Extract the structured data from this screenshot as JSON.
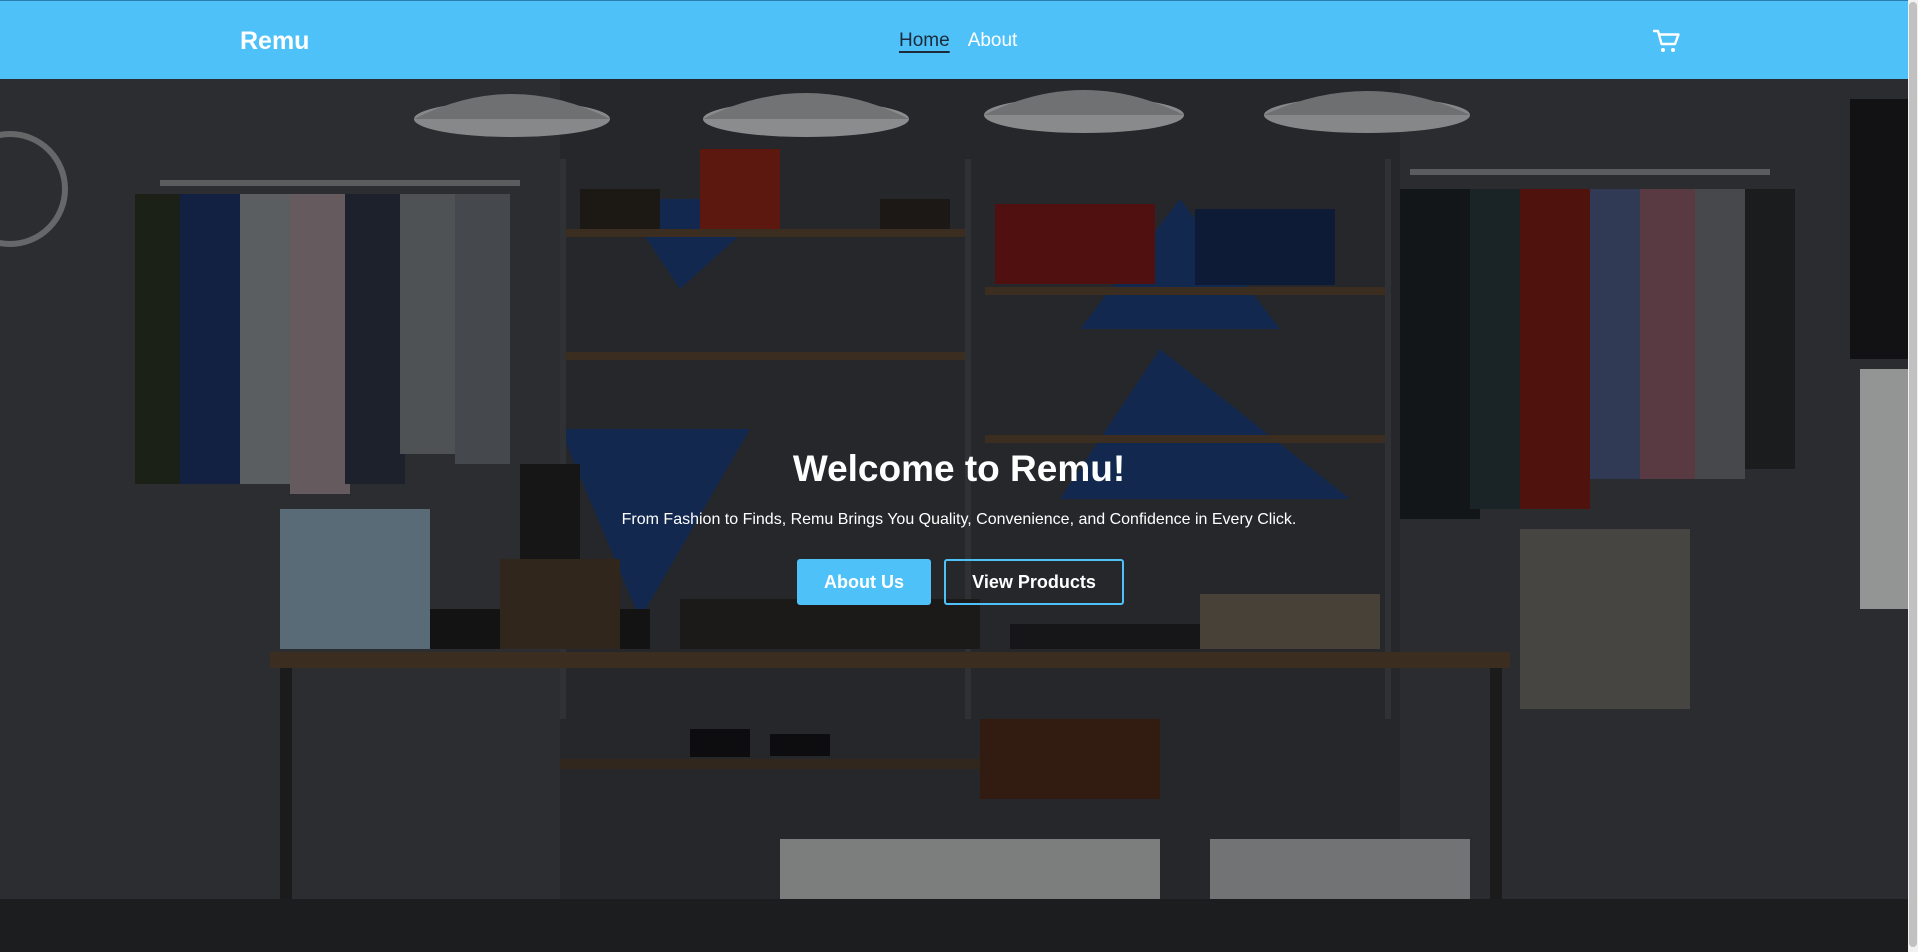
{
  "navbar": {
    "brand": "Remu",
    "links": [
      {
        "label": "Home",
        "active": true
      },
      {
        "label": "About",
        "active": false
      }
    ],
    "cart_icon": "shopping-cart-icon"
  },
  "hero": {
    "title": "Welcome to Remu!",
    "subtitle": "From Fashion to Finds, Remu Brings You Quality, Convenience, and Confidence in Every Click.",
    "primary_button": "About Us",
    "secondary_button": "View Products",
    "background_image": "clothing-store-interior-photo"
  },
  "colors": {
    "accent": "#4fc1f9",
    "nav_active": "#1c2a3a",
    "text_light": "#ffffff"
  }
}
